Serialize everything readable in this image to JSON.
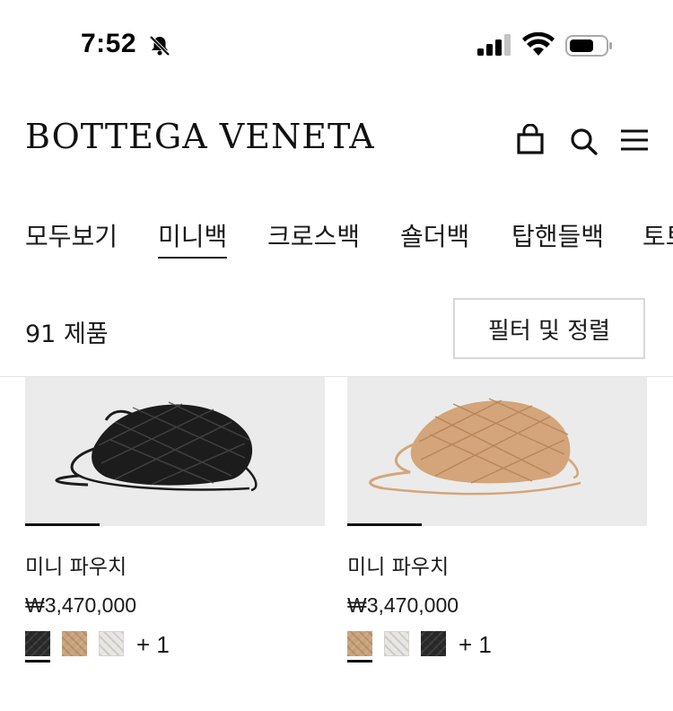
{
  "status": {
    "time": "7:52",
    "bell_icon": "bell-slash-icon",
    "signal_icon": "cellular-signal-icon",
    "wifi_icon": "wifi-icon",
    "battery_icon": "battery-icon"
  },
  "header": {
    "brand": "BOTTEGA VENETA",
    "icons": [
      "shopping-bag-icon",
      "search-icon",
      "menu-icon"
    ]
  },
  "tabs": [
    "모두보기",
    "미니백",
    "크로스백",
    "숄더백",
    "탑핸들백",
    "토트"
  ],
  "active_tab": "미니백",
  "listing": {
    "count": "91 제품",
    "filter_label": "필터 및 정렬"
  },
  "products": [
    {
      "name": "미니 파우치",
      "price": "₩3,470,000",
      "bag_color": "#1c1c1c",
      "swatches": [
        "#2a2a2a",
        "#c9a27a",
        "#e8e6e2"
      ],
      "selected_swatch": 0,
      "more": "+ 1"
    },
    {
      "name": "미니 파우치",
      "price": "₩3,470,000",
      "bag_color": "#d4a57a",
      "swatches": [
        "#c9a27a",
        "#e8e6e2",
        "#2a2a2a"
      ],
      "selected_swatch": 0,
      "more": "+ 1"
    }
  ]
}
